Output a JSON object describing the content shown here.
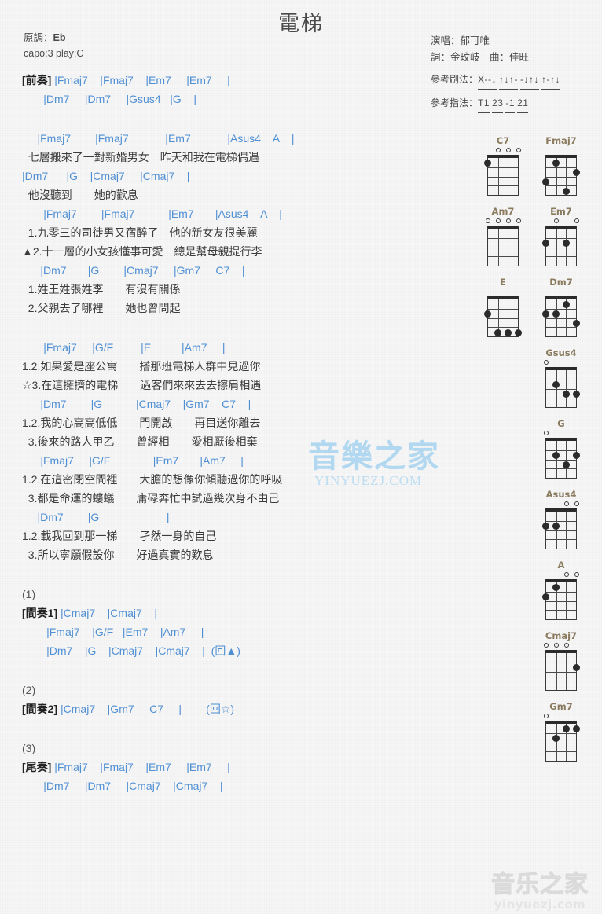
{
  "title": "電梯",
  "meta_left": {
    "key_label": "原調：",
    "key_value": "Eb",
    "capo": "capo:3 play:C"
  },
  "meta_right": {
    "singer": "演唱：郁可唯",
    "lyricist_composer": "詞：金玟岐　曲：佳旺",
    "strum_label": "參考刷法：",
    "strum_pattern": "X--↓ ↑↓↑- -↓↑↓ ↑-↑↓",
    "fingerstyle_label": "參考指法：",
    "fingerstyle_pattern": "T1 23 -1 21"
  },
  "colors": {
    "chord": "#4f8fd4",
    "lyric": "#3c3c3c",
    "chord_name": "#8a7a5e",
    "watermark_blue": "#7dc2ef",
    "background": "#f6f6f6"
  },
  "body_lines": [
    {
      "type": "chord",
      "text": "[前奏] |Fmaj7    |Fmaj7    |Em7     |Em7     |",
      "tag": "[前奏]"
    },
    {
      "type": "chord",
      "text": "       |Dm7     |Dm7     |Gsus4   |G    |"
    },
    {
      "type": "spacer",
      "text": ""
    },
    {
      "type": "spacer",
      "text": ""
    },
    {
      "type": "chord",
      "text": "     |Fmaj7        |Fmaj7            |Em7            |Asus4    A    |"
    },
    {
      "type": "lyric",
      "text": "  七層搬來了一對新婚男女　昨天和我在電梯偶遇"
    },
    {
      "type": "chord",
      "text": "|Dm7      |G    |Cmaj7     |Cmaj7    |"
    },
    {
      "type": "lyric",
      "text": "  他沒聽到　　她的歡息"
    },
    {
      "type": "chord",
      "text": "       |Fmaj7        |Fmaj7           |Em7       |Asus4    A    |"
    },
    {
      "type": "lyric",
      "text": "  1.九零三的司徒男又宿醉了　他的新女友很美麗"
    },
    {
      "type": "lyric",
      "text": "▲2.十一層的小女孩懂事可愛　總是幫母親提行李"
    },
    {
      "type": "chord",
      "text": "      |Dm7       |G        |Cmaj7     |Gm7     C7    |"
    },
    {
      "type": "lyric",
      "text": "  1.姓王姓張姓李　　有沒有關係"
    },
    {
      "type": "lyric",
      "text": "  2.父親去了哪裡　　她也曾問起"
    },
    {
      "type": "spacer",
      "text": ""
    },
    {
      "type": "spacer",
      "text": ""
    },
    {
      "type": "chord",
      "text": "       |Fmaj7     |G/F         |E          |Am7     |"
    },
    {
      "type": "lyric",
      "text": "1.2.如果愛是座公寓　　搭那班電梯人群中見過你"
    },
    {
      "type": "lyric",
      "text": "☆3.在這擁擠的電梯　　過客們來來去去擦肩相遇"
    },
    {
      "type": "chord",
      "text": "      |Dm7        |G           |Cmaj7    |Gm7    C7    |"
    },
    {
      "type": "lyric",
      "text": "1.2.我的心高高低低　　門開啟　　再目送你離去"
    },
    {
      "type": "lyric",
      "text": "  3.後來的路人甲乙　　曾經相　　愛相厭後相棄"
    },
    {
      "type": "chord",
      "text": "      |Fmaj7     |G/F              |Em7       |Am7     |"
    },
    {
      "type": "lyric",
      "text": "1.2.在這密閉空間裡　　大膽的想像你傾聽過你的呼吸"
    },
    {
      "type": "lyric",
      "text": "  3.都是命運的螻蟻　　庸碌奔忙中試過幾次身不由己"
    },
    {
      "type": "chord",
      "text": "     |Dm7        |G                      |"
    },
    {
      "type": "lyric",
      "text": "1.2.載我回到那一梯　　孑然一身的自己"
    },
    {
      "type": "lyric",
      "text": "  3.所以寧願假設你　　好過真實的歎息"
    },
    {
      "type": "spacer",
      "text": ""
    },
    {
      "type": "spacer",
      "text": ""
    },
    {
      "type": "sec",
      "text": "(1)"
    },
    {
      "type": "chord",
      "text": "[間奏1] |Cmaj7    |Cmaj7    |",
      "tag": "[間奏1]"
    },
    {
      "type": "chord",
      "text": "        |Fmaj7    |G/F   |Em7    |Am7     |"
    },
    {
      "type": "chord",
      "text": "        |Dm7    |G    |Cmaj7    |Cmaj7    |  (回▲)"
    },
    {
      "type": "spacer",
      "text": ""
    },
    {
      "type": "spacer",
      "text": ""
    },
    {
      "type": "sec",
      "text": "(2)"
    },
    {
      "type": "chord",
      "text": "[間奏2] |Cmaj7    |Gm7     C7     |        (回☆)",
      "tag": "[間奏2]"
    },
    {
      "type": "spacer",
      "text": ""
    },
    {
      "type": "spacer",
      "text": ""
    },
    {
      "type": "sec",
      "text": "(3)"
    },
    {
      "type": "chord",
      "text": "[尾奏] |Fmaj7    |Fmaj7    |Em7     |Em7     |",
      "tag": "[尾奏]"
    },
    {
      "type": "chord",
      "text": "       |Dm7     |Dm7     |Cmaj7    |Cmaj7    |"
    }
  ],
  "chord_diagrams": [
    {
      "name": "C7",
      "col": "left",
      "opens": [
        1,
        2,
        3
      ],
      "dots": [
        {
          "string": 4,
          "fret": 1
        }
      ]
    },
    {
      "name": "Fmaj7",
      "col": "right",
      "opens": [],
      "dots": [
        {
          "string": 3,
          "fret": 1
        },
        {
          "string": 1,
          "fret": 2
        },
        {
          "string": 4,
          "fret": 3
        },
        {
          "string": 2,
          "fret": 4
        }
      ]
    },
    {
      "name": "Am7",
      "col": "left",
      "opens": [
        1,
        2,
        3,
        4
      ],
      "dots": []
    },
    {
      "name": "Em7",
      "col": "right",
      "opens": [
        1,
        3
      ],
      "dots": [
        {
          "string": 2,
          "fret": 2
        },
        {
          "string": 4,
          "fret": 2
        }
      ]
    },
    {
      "name": "E",
      "col": "left",
      "opens": [],
      "dots": [
        {
          "string": 4,
          "fret": 2
        },
        {
          "string": 1,
          "fret": 4
        },
        {
          "string": 2,
          "fret": 4
        },
        {
          "string": 3,
          "fret": 4
        }
      ]
    },
    {
      "name": "Dm7",
      "col": "right",
      "opens": [],
      "dots": [
        {
          "string": 2,
          "fret": 1
        },
        {
          "string": 4,
          "fret": 2
        },
        {
          "string": 3,
          "fret": 2
        },
        {
          "string": 1,
          "fret": 3
        }
      ]
    },
    {
      "name": "Gsus4",
      "col": "right",
      "opens": [
        4
      ],
      "dots": [
        {
          "string": 3,
          "fret": 2
        },
        {
          "string": 2,
          "fret": 3
        },
        {
          "string": 1,
          "fret": 3
        }
      ]
    },
    {
      "name": "G",
      "col": "right",
      "opens": [
        4
      ],
      "dots": [
        {
          "string": 3,
          "fret": 2
        },
        {
          "string": 1,
          "fret": 2
        },
        {
          "string": 2,
          "fret": 3
        }
      ]
    },
    {
      "name": "Asus4",
      "col": "right",
      "opens": [
        1,
        2
      ],
      "dots": [
        {
          "string": 4,
          "fret": 2
        },
        {
          "string": 3,
          "fret": 2
        }
      ]
    },
    {
      "name": "A",
      "col": "right",
      "opens": [
        1,
        2
      ],
      "dots": [
        {
          "string": 3,
          "fret": 1
        },
        {
          "string": 4,
          "fret": 2
        }
      ]
    },
    {
      "name": "Cmaj7",
      "col": "right",
      "opens": [
        2,
        3,
        4
      ],
      "dots": [
        {
          "string": 1,
          "fret": 2
        }
      ]
    },
    {
      "name": "Gm7",
      "col": "right",
      "opens": [
        4
      ],
      "dots": [
        {
          "string": 2,
          "fret": 1
        },
        {
          "string": 1,
          "fret": 1
        },
        {
          "string": 3,
          "fret": 2
        }
      ]
    }
  ],
  "watermarks": {
    "center_text": "音樂之家",
    "center_url": "YINYUEZJ.COM",
    "bottom_text": "音乐之家",
    "bottom_url": "yinyuezj.com"
  }
}
